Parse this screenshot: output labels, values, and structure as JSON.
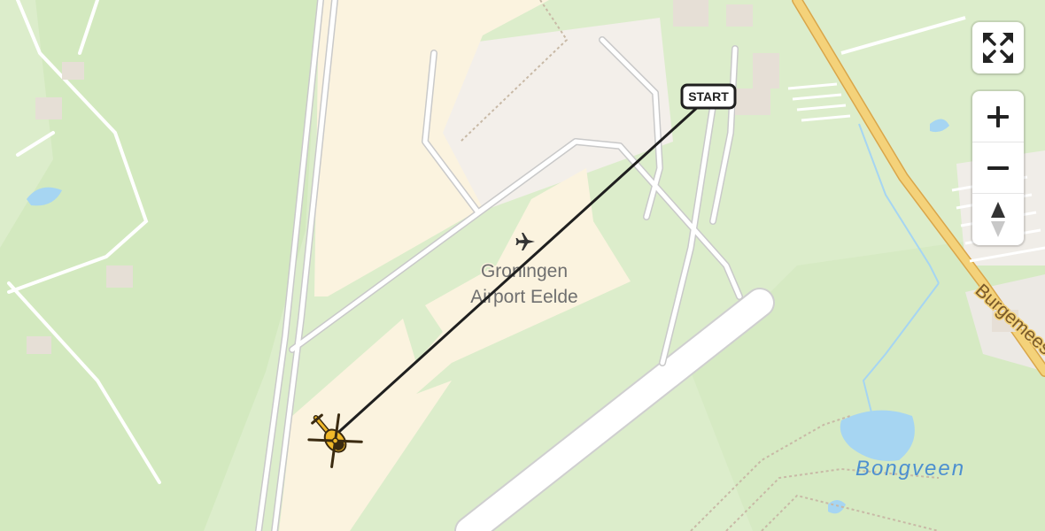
{
  "map": {
    "airport_name_line1": "Groningen",
    "airport_name_line2": "Airport Eelde",
    "area_label": "Bongveen",
    "road_label": "Burgemees",
    "route_start_label": "START"
  },
  "controls": {
    "fullscreen_icon": "expand-arrows-icon",
    "zoom_in_icon": "plus-icon",
    "zoom_out_icon": "minus-icon",
    "compass_icon": "north-arrow-icon"
  },
  "colors": {
    "land": "#dcedcb",
    "forest": "#cfe6bb",
    "airport": "#fbf3df",
    "built": "#f3efea",
    "water": "#9fd3f2",
    "road": "#ffffff",
    "main_road": "#f4d27a",
    "route_line": "#1f1f1f",
    "helicopter": "#f0b82a"
  }
}
